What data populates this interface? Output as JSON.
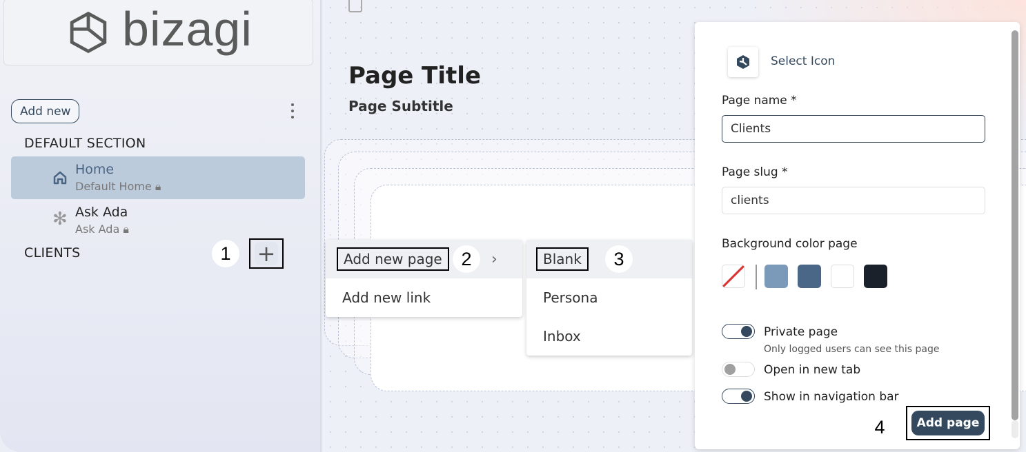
{
  "sidebar": {
    "logo": "bizagi",
    "add_new": "Add new",
    "sections": [
      {
        "label": "DEFAULT SECTION"
      },
      {
        "label": "CLIENTS"
      }
    ],
    "items": [
      {
        "title": "Home",
        "subtitle": "Default Home",
        "icon": "home-icon"
      },
      {
        "title": "Ask Ada",
        "subtitle": "Ask Ada",
        "icon": "asterisk-icon"
      }
    ]
  },
  "main": {
    "title": "Page Title",
    "subtitle": "Page Subtitle"
  },
  "menu": {
    "items": [
      "Add new page",
      "Add new link"
    ]
  },
  "submenu": {
    "items": [
      "Blank",
      "Persona",
      "Inbox"
    ]
  },
  "annotations": [
    "1",
    "2",
    "3",
    "4"
  ],
  "panel": {
    "select_icon": "Select Icon",
    "page_name_label": "Page name *",
    "page_name_value": "Clients",
    "page_slug_label": "Page slug *",
    "page_slug_value": "clients",
    "bg_color_label": "Background color page",
    "swatches": [
      "none",
      "#7b9aba",
      "#4a6787",
      "#ffffff",
      "#1a212b"
    ],
    "toggles": [
      {
        "label": "Private page",
        "hint": "Only logged users can see this page",
        "on": true
      },
      {
        "label": "Open in new tab",
        "on": false
      },
      {
        "label": "Show in navigation bar",
        "on": true
      }
    ],
    "add_page": "Add page",
    "accent": "#34495e"
  }
}
